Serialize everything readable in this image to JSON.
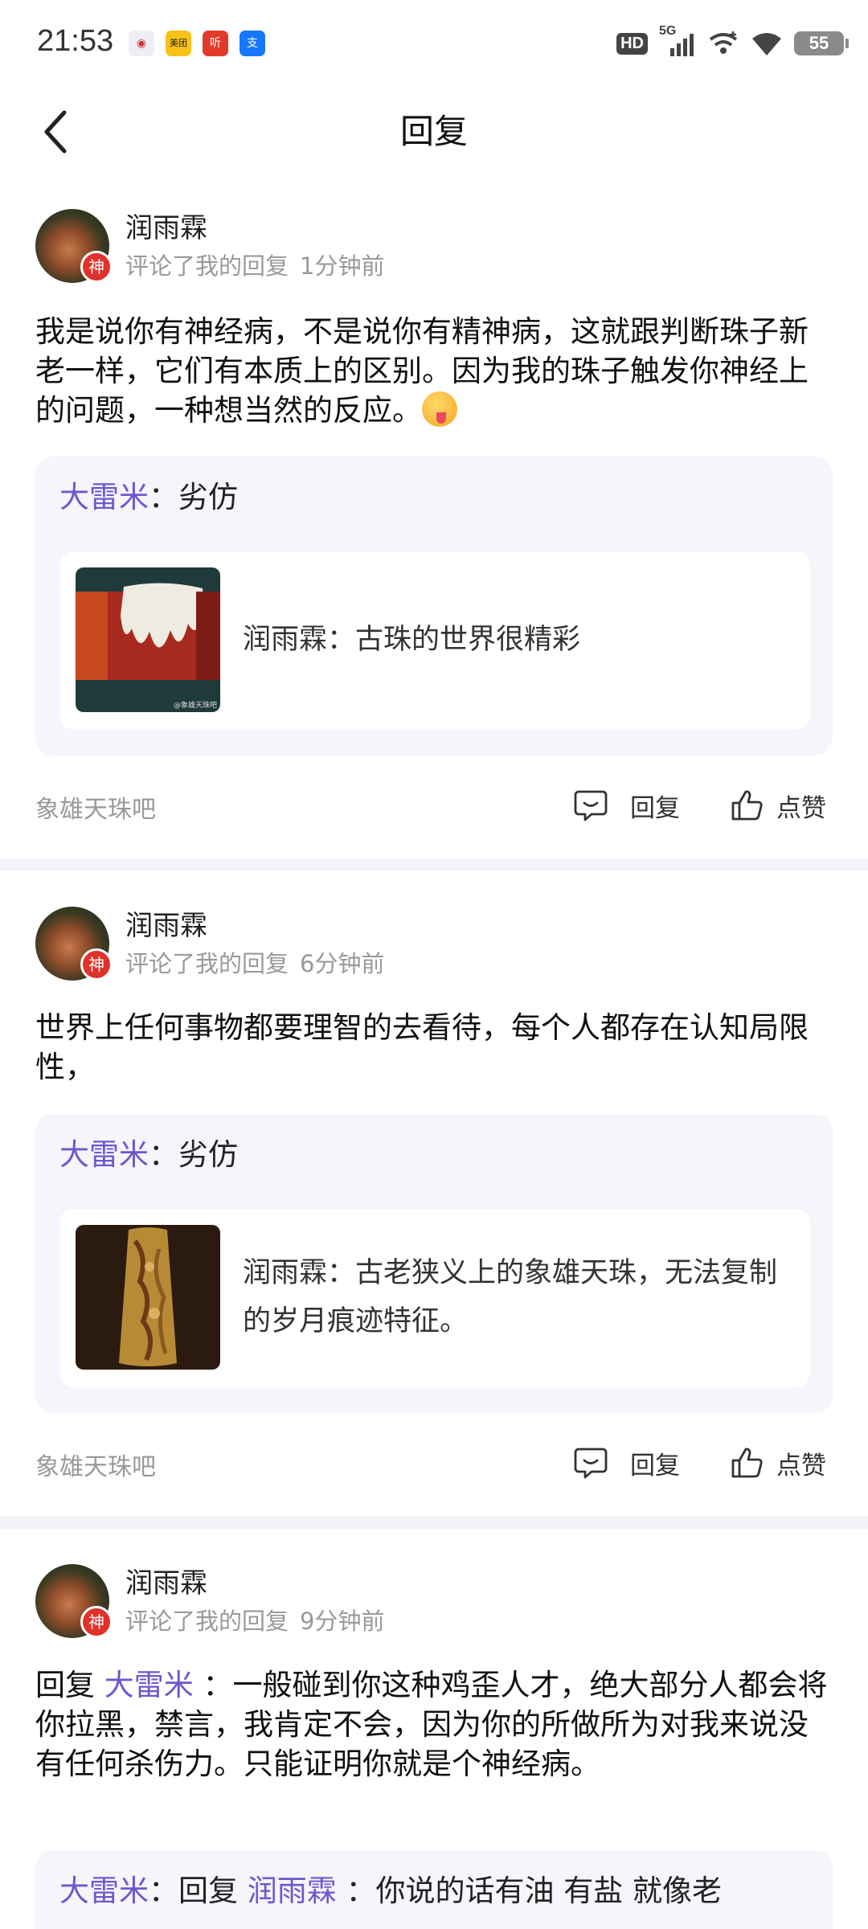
{
  "status": {
    "time": "21:53",
    "app_icons": [
      {
        "name": "hm-app-icon",
        "color": "#e8e8f0",
        "glyph": "🚲"
      },
      {
        "name": "meituan-app-icon",
        "color": "#f7c31a",
        "glyph": "美团"
      },
      {
        "name": "tingshu-app-icon",
        "color": "#e23a2a",
        "glyph": "听"
      },
      {
        "name": "alipay-app-icon",
        "color": "#1677ff",
        "glyph": "支"
      }
    ],
    "hd": "HD",
    "network": "5G",
    "battery": "55"
  },
  "header": {
    "title": "回复"
  },
  "cards": [
    {
      "username": "润雨霖",
      "badge": "神",
      "action": "评论了我的回复",
      "time": "1分钟前",
      "text": "我是说你有神经病，不是说你有精神病，这就跟判断珠子新老一样，它们有本质上的区别。因为我的珠子触发你神经上的问题，一种想当然的反应。",
      "quote_user": "大雷米",
      "quote_sep": "：",
      "quote_text": "劣仿",
      "inner_user": "润雨霖",
      "inner_sep": "：",
      "inner_text": "古珠的世界很精彩",
      "thumb_watermark": "@象雄天珠吧",
      "source": "象雄天珠吧",
      "reply": "回复",
      "like": "点赞"
    },
    {
      "username": "润雨霖",
      "badge": "神",
      "action": "评论了我的回复",
      "time": "6分钟前",
      "text": "世界上任何事物都要理智的去看待，每个人都存在认知局限性，",
      "quote_user": "大雷米",
      "quote_sep": "：",
      "quote_text": "劣仿",
      "inner_user": "润雨霖",
      "inner_sep": "：",
      "inner_text": "古老狭义上的象雄天珠，无法复制的岁月痕迹特征。",
      "source": "象雄天珠吧",
      "reply": "回复",
      "like": "点赞"
    },
    {
      "username": "润雨霖",
      "badge": "神",
      "action": "评论了我的回复",
      "time": "9分钟前",
      "reply_prefix": "回复",
      "reply_target": "大雷米",
      "text": "：一般碰到你这种鸡歪人才，绝大部分人都会将你拉黑，禁言，我肯定不会，因为你的所做所为对我来说没有任何杀伤力。只能证明你就是个神经病。",
      "quote_user": "大雷米",
      "quote_sep": "：",
      "quote_reply_word": "回复",
      "quote_target": "润雨霖",
      "quote_text": "：你说的话有油 有盐 就像老"
    }
  ],
  "colors": {
    "accent": "#6a5acd",
    "quote_bg": "#f5f5fc",
    "divider": "#f3f3f8",
    "badge": "#e0312a"
  }
}
